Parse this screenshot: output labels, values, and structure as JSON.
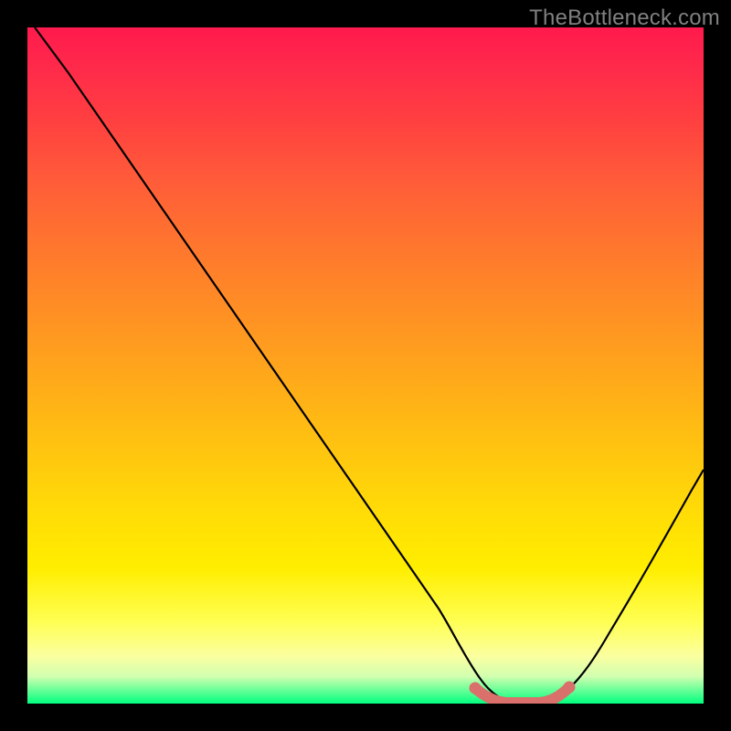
{
  "watermark": "TheBottleneck.com",
  "chart_data": {
    "type": "line",
    "title": "",
    "xlabel": "",
    "ylabel": "",
    "xlim": [
      0,
      100
    ],
    "ylim": [
      0,
      100
    ],
    "x": [
      0,
      5,
      10,
      15,
      20,
      25,
      30,
      35,
      40,
      45,
      50,
      55,
      60,
      62,
      64,
      66,
      68,
      70,
      72,
      74,
      76,
      78,
      82,
      86,
      90,
      94,
      98,
      100
    ],
    "y": [
      100,
      93,
      86,
      79,
      72,
      65,
      58,
      51,
      44,
      37,
      30,
      22,
      13,
      8,
      4,
      1.5,
      0.5,
      0,
      0,
      0,
      0,
      0.5,
      2.5,
      7,
      13,
      20,
      28,
      33
    ],
    "highlight_segment": {
      "x_start": 62,
      "x_end": 78,
      "color": "#d9706b"
    },
    "background_gradient": {
      "stops": [
        {
          "pos": 0,
          "color": "#ff1a4d"
        },
        {
          "pos": 100,
          "color": "#00ff7f"
        }
      ]
    }
  }
}
